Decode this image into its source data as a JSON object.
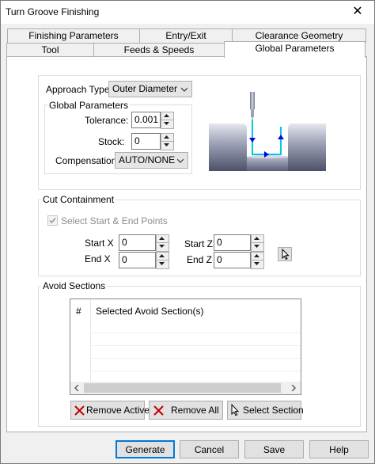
{
  "window": {
    "title": "Turn Groove Finishing",
    "close_glyph": "✕"
  },
  "tabs": {
    "row_back": [
      "Finishing Parameters",
      "Entry/Exit",
      "Clearance Geometry"
    ],
    "row_front": [
      "Tool",
      "Feeds & Speeds",
      "Global Parameters"
    ],
    "active": "Global Parameters"
  },
  "approach": {
    "label": "Approach Type",
    "value": "Outer Diameter"
  },
  "global_params": {
    "title": "Global Parameters",
    "tolerance_label": "Tolerance:",
    "tolerance_value": "0.001",
    "stock_label": "Stock:",
    "stock_value": "0",
    "compensation_label": "Compensation:",
    "compensation_value": "AUTO/NONE"
  },
  "cut_containment": {
    "title": "Cut Containment",
    "select_points_label": "Select Start & End Points",
    "select_points_checked": true,
    "start_x_label": "Start X",
    "start_x_value": "0",
    "end_x_label": "End X",
    "end_x_value": "0",
    "start_z_label": "Start Z",
    "start_z_value": "0",
    "end_z_label": "End Z",
    "end_z_value": "0"
  },
  "avoid_sections": {
    "title": "Avoid Sections",
    "col_num": "#",
    "col_name": "Selected Avoid Section(s)",
    "rows": [],
    "remove_active": "Remove Active",
    "remove_all": "Remove All",
    "select_section": "Select Section"
  },
  "footer": {
    "generate": "Generate",
    "cancel": "Cancel",
    "save": "Save",
    "help": "Help"
  },
  "colors": {
    "accent": "#0078d7",
    "toolpath": "#00c8e6",
    "arrow": "#0000dd",
    "part": "#8a8fa8"
  }
}
